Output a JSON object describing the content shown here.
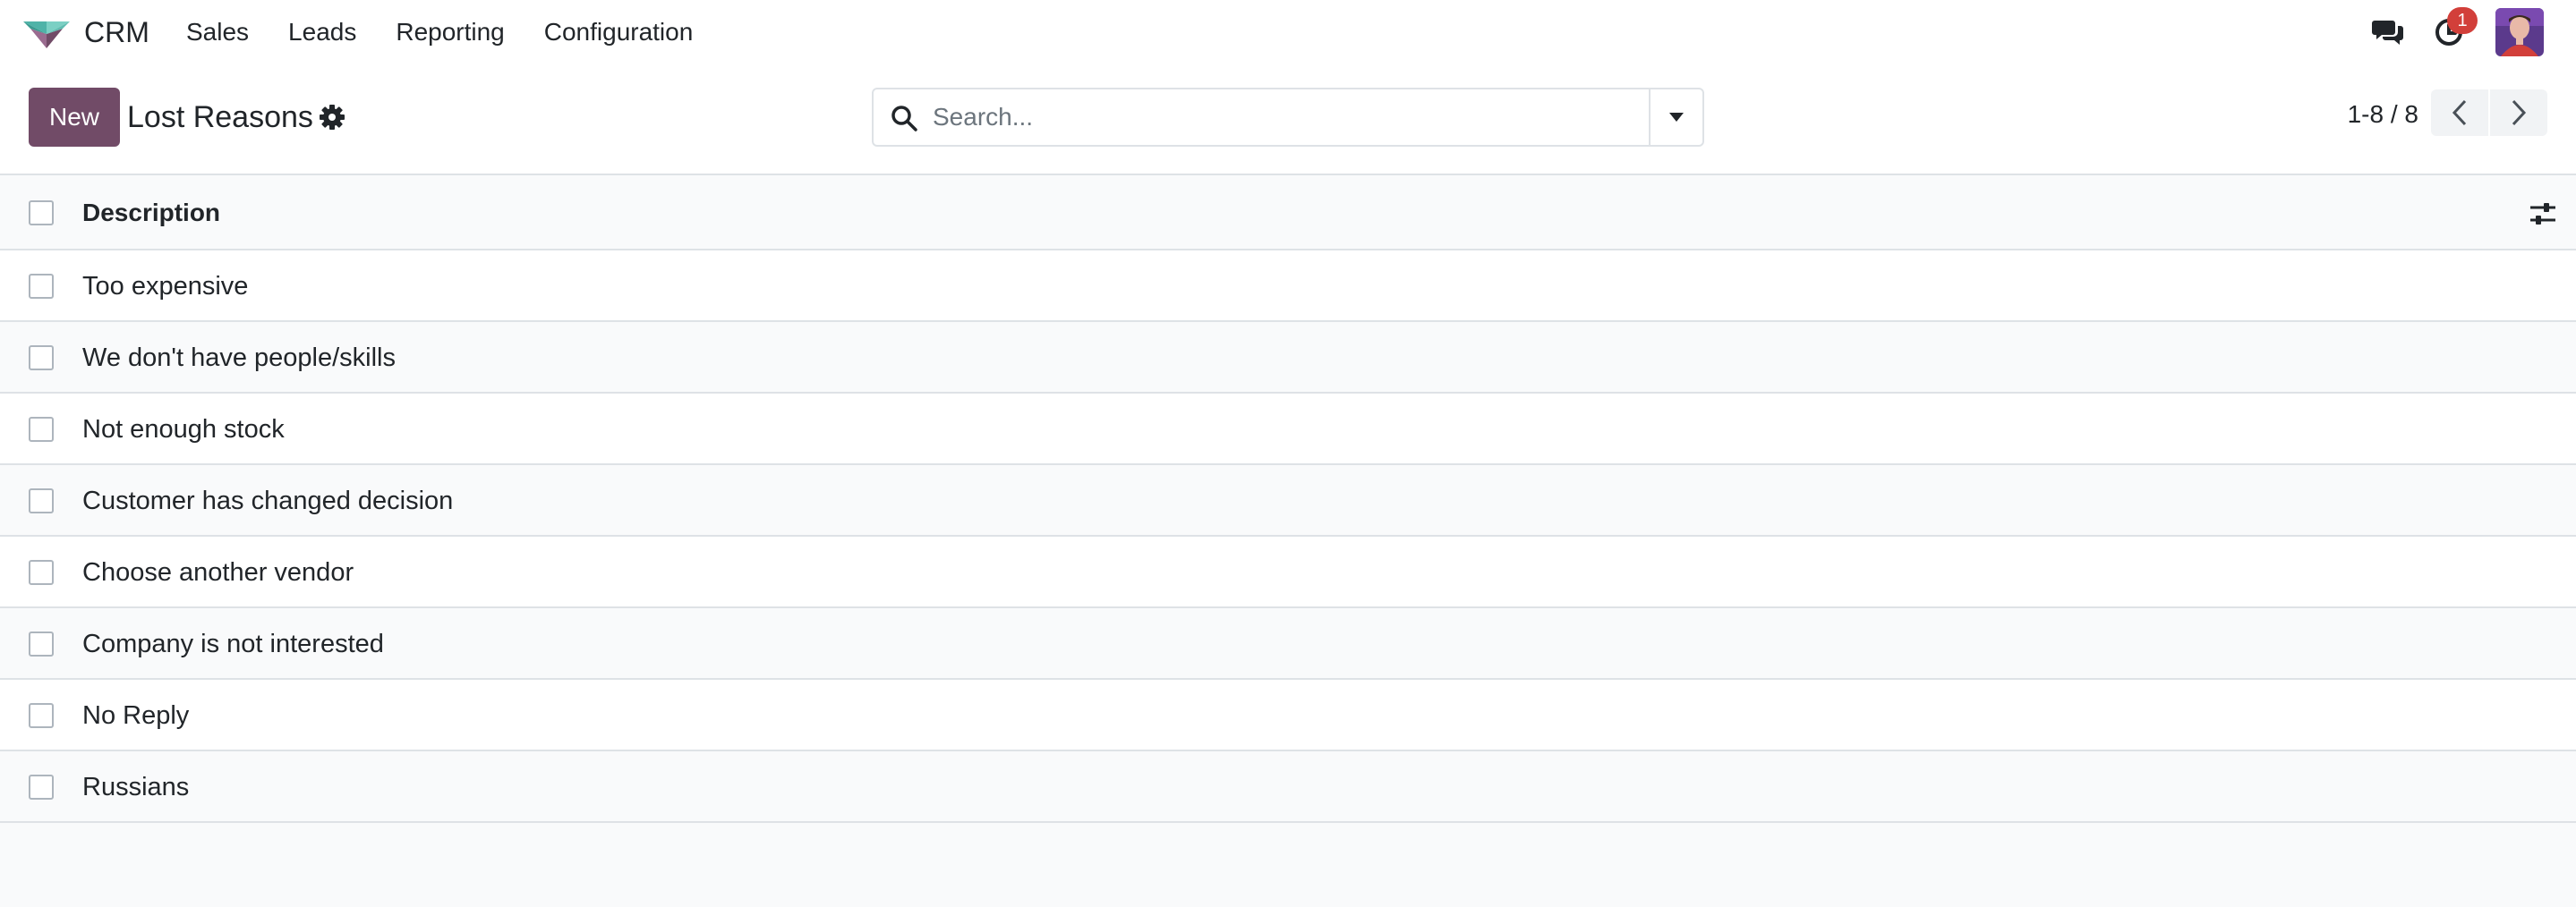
{
  "navbar": {
    "app_name": "CRM",
    "menu": [
      "Sales",
      "Leads",
      "Reporting",
      "Configuration"
    ],
    "activity_count": "1",
    "icons": [
      "app-logo-icon",
      "chat-icon",
      "clock-icon",
      "avatar"
    ]
  },
  "control_panel": {
    "new_label": "New",
    "title": "Lost Reasons",
    "search_placeholder": "Search...",
    "pager": "1-8 / 8"
  },
  "list": {
    "column": "Description",
    "rows": [
      "Too expensive",
      "We don't have people/skills",
      "Not enough stock",
      "Customer has changed decision",
      "Choose another vendor",
      "Company is not interested",
      "No Reply",
      "Russians"
    ]
  },
  "colors": {
    "brand": "#714b67",
    "badge": "#d23f3a",
    "border": "#dee2e6"
  }
}
